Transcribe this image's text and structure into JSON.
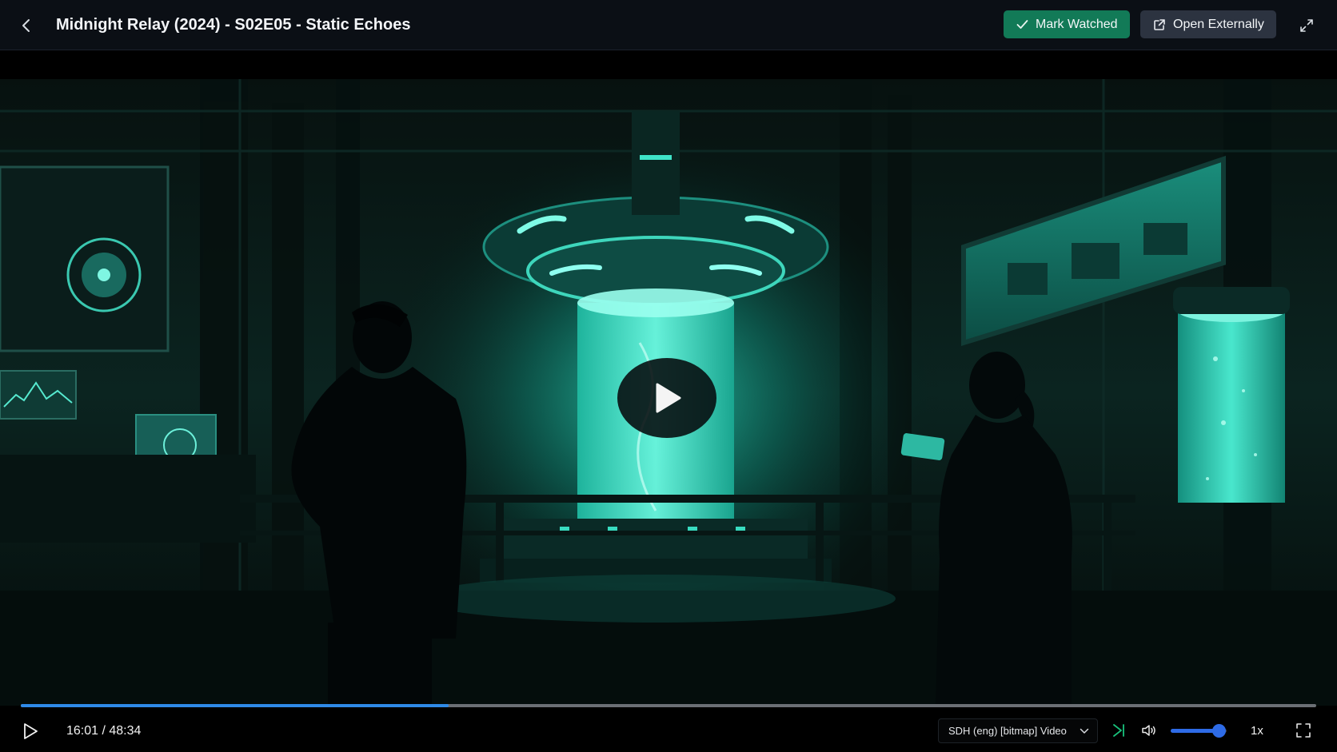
{
  "header": {
    "title": "Midnight Relay (2024) - S02E05 - Static Echoes",
    "mark_watched_label": "Mark Watched",
    "open_externally_label": "Open Externally",
    "icons": {
      "back": "chevron-left-icon",
      "mark_watched": "check-icon",
      "open_externally": "external-link-icon",
      "expand": "expand-diagonal-icon"
    }
  },
  "colors": {
    "mark_watched_bg": "#127a57",
    "open_externally_bg": "#2c3340",
    "progress_fill": "#2f8ae8",
    "volume_accent": "#2e6be6",
    "skip_icon": "#19c37d"
  },
  "video": {
    "poster_description_icon": "video-frame-image",
    "big_play_icon": "play-icon"
  },
  "player": {
    "current_time": "16:01",
    "duration": "48:34",
    "timecode": "16:01 / 48:34",
    "progress_fraction": 0.33,
    "subtitle_track": "SDH (eng) [bitmap] Video",
    "volume_fraction": 0.85,
    "speed": "1x",
    "icons": {
      "play": "play-icon",
      "skip": "skip-forward-icon",
      "volume": "volume-icon",
      "fullscreen": "fullscreen-icon",
      "dropdown": "chevron-down-icon"
    }
  }
}
